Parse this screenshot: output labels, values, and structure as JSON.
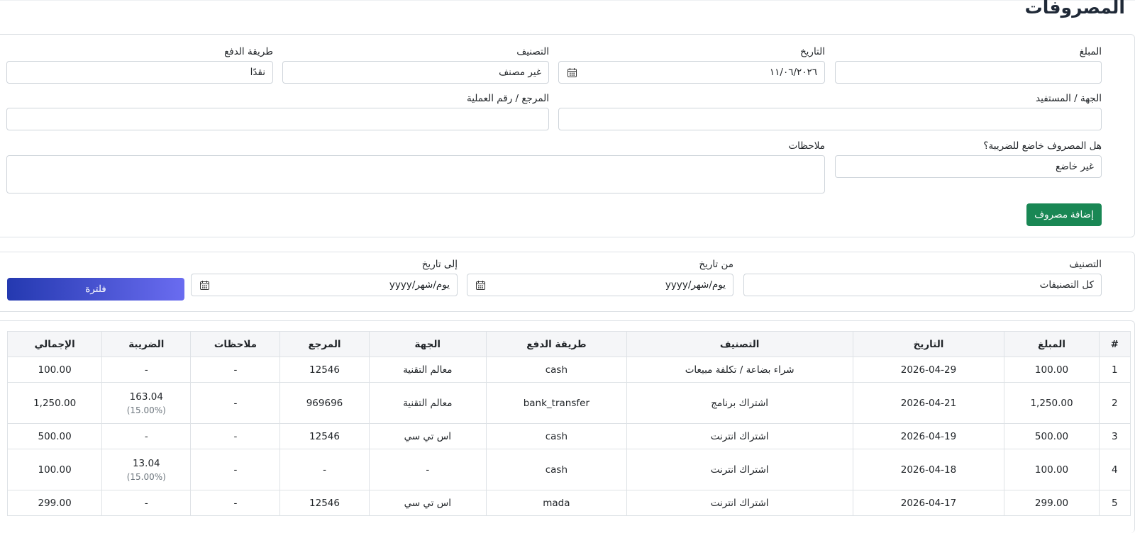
{
  "page": {
    "title": "المصروفات"
  },
  "form": {
    "amount_label": "المبلغ",
    "amount_value": "",
    "date_label": "التاريخ",
    "date_value": "١١/٠٦/٢٠٢٦",
    "category_label": "التصنيف",
    "category_value": "غير مصنف",
    "payment_label": "طريقة الدفع",
    "payment_value": "نقدًا",
    "payee_label": "الجهة / المستفيد",
    "payee_value": "",
    "reference_label": "المرجع / رقم العملية",
    "reference_value": "",
    "taxable_label": "هل المصروف خاضع للضريبة؟",
    "taxable_value": "غير خاضع",
    "notes_label": "ملاحظات",
    "notes_value": "",
    "add_button": "إضافة مصروف"
  },
  "filter": {
    "category_label": "التصنيف",
    "category_value": "كل التصنيفات",
    "from_label": "من تاريخ",
    "from_placeholder": "يوم/شهر/yyyy",
    "to_label": "إلى تاريخ",
    "to_placeholder": "يوم/شهر/yyyy",
    "filter_button": "فلترة"
  },
  "table": {
    "headers": [
      "#",
      "المبلغ",
      "التاريخ",
      "التصنيف",
      "طريقة الدفع",
      "الجهة",
      "المرجع",
      "ملاحظات",
      "الضريبة",
      "الإجمالي"
    ],
    "rows": [
      {
        "num": "1",
        "amount": "100.00",
        "date": "2026-04-29",
        "category": "شراء بضاعة / تكلفة مبيعات",
        "payment": "cash",
        "payee": "معالم التقنية",
        "ref": "12546",
        "notes": "-",
        "tax": "-",
        "tax_pct": "",
        "total": "100.00"
      },
      {
        "num": "2",
        "amount": "1,250.00",
        "date": "2026-04-21",
        "category": "اشتراك برنامج",
        "payment": "bank_transfer",
        "payee": "معالم التقنية",
        "ref": "969696",
        "notes": "-",
        "tax": "163.04",
        "tax_pct": "(15.00%)",
        "total": "1,250.00"
      },
      {
        "num": "3",
        "amount": "500.00",
        "date": "2026-04-19",
        "category": "اشتراك انترنت",
        "payment": "cash",
        "payee": "اس تي سي",
        "ref": "12546",
        "notes": "-",
        "tax": "-",
        "tax_pct": "",
        "total": "500.00"
      },
      {
        "num": "4",
        "amount": "100.00",
        "date": "2026-04-18",
        "category": "اشتراك انترنت",
        "payment": "cash",
        "payee": "-",
        "ref": "-",
        "notes": "-",
        "tax": "13.04",
        "tax_pct": "(15.00%)",
        "total": "100.00"
      },
      {
        "num": "5",
        "amount": "299.00",
        "date": "2026-04-17",
        "category": "اشتراك انترنت",
        "payment": "mada",
        "payee": "اس تي سي",
        "ref": "12546",
        "notes": "-",
        "tax": "-",
        "tax_pct": "",
        "total": "299.00"
      }
    ]
  },
  "colors": {
    "add_button": "#198754",
    "filter_button_start": "#6a6cf0",
    "filter_button_end": "#2439b0",
    "header_bg": "#f5f6f8"
  }
}
